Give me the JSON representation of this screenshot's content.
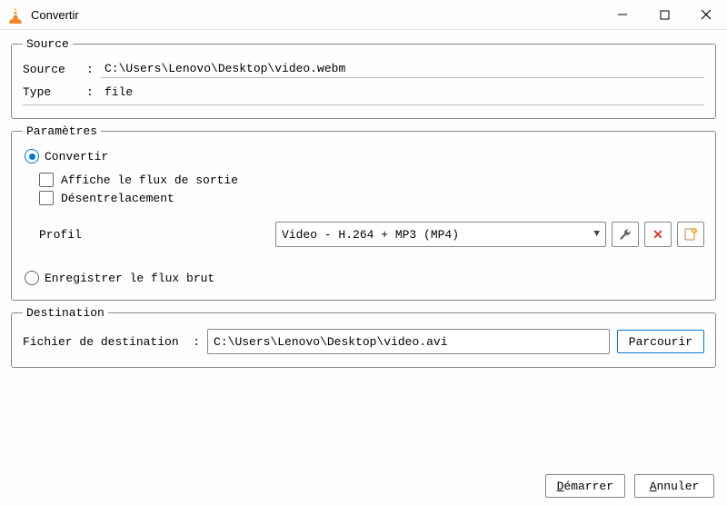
{
  "window": {
    "title": "Convertir"
  },
  "source": {
    "legend": "Source",
    "source_label": "Source",
    "source_value": "C:\\Users\\Lenovo\\Desktop\\video.webm",
    "type_label": "Type",
    "type_value": "file"
  },
  "params": {
    "legend": "Paramètres",
    "radio_convert": "Convertir",
    "check_display_output": "Affiche le flux de sortie",
    "check_deinterlace": "Désentrelacement",
    "profile_label": "Profil",
    "profile_value": "Video - H.264 + MP3 (MP4)",
    "radio_save_raw": "Enregistrer le flux brut"
  },
  "destination": {
    "legend": "Destination",
    "label": "Fichier de destination",
    "value": "C:\\Users\\Lenovo\\Desktop\\video.avi",
    "browse": "Parcourir"
  },
  "footer": {
    "start_prefix": "D",
    "start_rest": "émarrer",
    "cancel_prefix": "A",
    "cancel_rest": "nnuler"
  },
  "colors": {
    "accent": "#0078d7",
    "delete_icon": "#d43a2c"
  }
}
